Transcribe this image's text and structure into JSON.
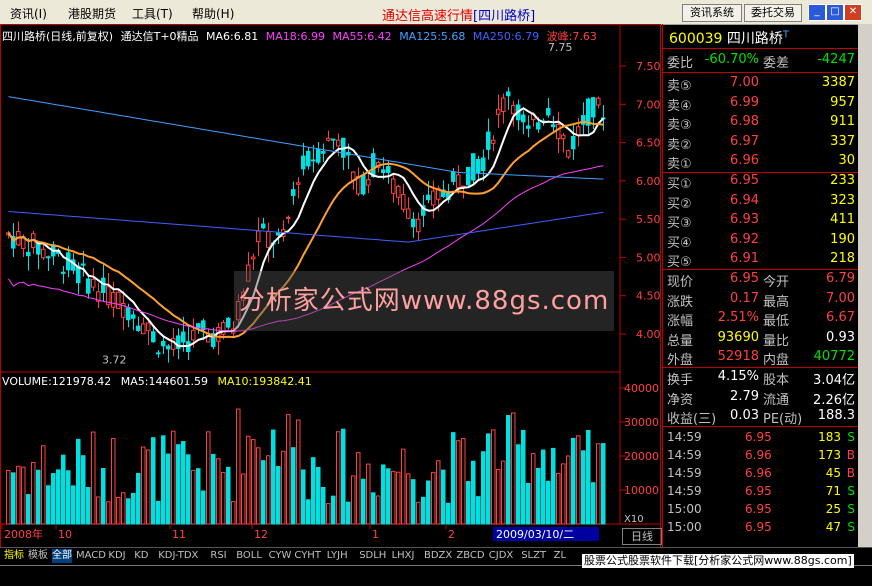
{
  "menu": {
    "items": [
      "资讯(I)",
      "港股期货",
      "工具(T)",
      "帮助(H)"
    ],
    "title_main": "通达信高速行情",
    "title_stock": "[四川路桥]",
    "btn_news": "资讯系统",
    "btn_trade": "委托交易"
  },
  "chart": {
    "header_name": "四川路桥(日线,前复权)",
    "header_formula": "通达信T+0精品",
    "ma6": "MA6:6.81",
    "ma18": "MA18:6.99",
    "ma55": "MA55:6.42",
    "ma125": "MA125:5.68",
    "ma250": "MA250:6.79",
    "wave": "波峰:7.63",
    "high_label": "7.75",
    "low_label": "3.72",
    "price_ticks": [
      "7.50",
      "7.00",
      "6.50",
      "6.00",
      "5.50",
      "5.00",
      "4.50",
      "4.00"
    ],
    "volume_header": "VOLUME:121978.42",
    "vol_ma5": "MA5:144601.59",
    "vol_ma10": "MA10:193842.41",
    "vol_ticks": [
      "40000",
      "30000",
      "20000",
      "10000"
    ],
    "vol_unit": "X10",
    "date_labels": [
      "2008年",
      "10",
      "11",
      "12",
      "1",
      "2"
    ],
    "cursor_date": "2009/03/10/二",
    "period": "日线",
    "watermark": "分析家公式网www.88gs.com"
  },
  "quote": {
    "code": "600039",
    "name": "四川路桥",
    "suffix": "T",
    "weibi_label": "委比",
    "weibi": "-60.70%",
    "weicha_label": "委差",
    "weicha": "-4247",
    "asks": [
      {
        "label": "卖⑤",
        "price": "7.00",
        "vol": "3387"
      },
      {
        "label": "卖④",
        "price": "6.99",
        "vol": "957"
      },
      {
        "label": "卖③",
        "price": "6.98",
        "vol": "911"
      },
      {
        "label": "卖②",
        "price": "6.97",
        "vol": "337"
      },
      {
        "label": "卖①",
        "price": "6.96",
        "vol": "30"
      }
    ],
    "bids": [
      {
        "label": "买①",
        "price": "6.95",
        "vol": "233"
      },
      {
        "label": "买②",
        "price": "6.94",
        "vol": "323"
      },
      {
        "label": "买③",
        "price": "6.93",
        "vol": "411"
      },
      {
        "label": "买④",
        "price": "6.92",
        "vol": "190"
      },
      {
        "label": "买⑤",
        "price": "6.91",
        "vol": "218"
      }
    ],
    "stats1": [
      {
        "l1": "现价",
        "v1": "6.95",
        "l2": "今开",
        "v2": "6.79"
      },
      {
        "l1": "涨跌",
        "v1": "0.17",
        "l2": "最高",
        "v2": "7.00"
      },
      {
        "l1": "涨幅",
        "v1": "2.51%",
        "l2": "最低",
        "v2": "6.67"
      },
      {
        "l1": "总量",
        "v1": "93690",
        "l2": "量比",
        "v2": "0.93"
      },
      {
        "l1": "外盘",
        "v1": "52918",
        "l2": "内盘",
        "v2": "40772"
      }
    ],
    "stats2": [
      {
        "l1": "换手",
        "v1": "4.15%",
        "l2": "股本",
        "v2": "3.04亿"
      },
      {
        "l1": "净资",
        "v1": "2.79",
        "l2": "流通",
        "v2": "2.26亿"
      },
      {
        "l1": "收益(三)",
        "v1": "0.03",
        "l2": "PE(动)",
        "v2": "188.3"
      }
    ],
    "ticks": [
      {
        "time": "14:59",
        "price": "6.95",
        "vol": "183",
        "side": "S"
      },
      {
        "time": "14:59",
        "price": "6.96",
        "vol": "173",
        "side": "B"
      },
      {
        "time": "14:59",
        "price": "6.96",
        "vol": "45",
        "side": "B"
      },
      {
        "time": "14:59",
        "price": "6.95",
        "vol": "71",
        "side": "S"
      },
      {
        "time": "15:00",
        "price": "6.95",
        "vol": "25",
        "side": "S"
      },
      {
        "time": "15:00",
        "price": "6.95",
        "vol": "47",
        "side": "S"
      }
    ]
  },
  "tabs": [
    "指标",
    "模板",
    "全部",
    "MACD",
    "KDJ",
    "KD",
    "KDJ-TDX",
    "RSI",
    "BOLL",
    "CYW",
    "CYHT",
    "LYJH",
    "SDLH",
    "LHXJ",
    "BDZX",
    "ZBCD",
    "CJDX",
    "SLZT",
    "ZL"
  ],
  "ad_text": "股票公式股票软件下载[分析家公式网www.88gs.com]",
  "colors": {
    "up": "#ff4040",
    "down": "#00e0e0",
    "ma6": "#ffffff",
    "ma18": "#ffa030",
    "ma55": "#ff40ff",
    "ma125": "#4060ff",
    "ma250": "#40a0ff"
  }
}
